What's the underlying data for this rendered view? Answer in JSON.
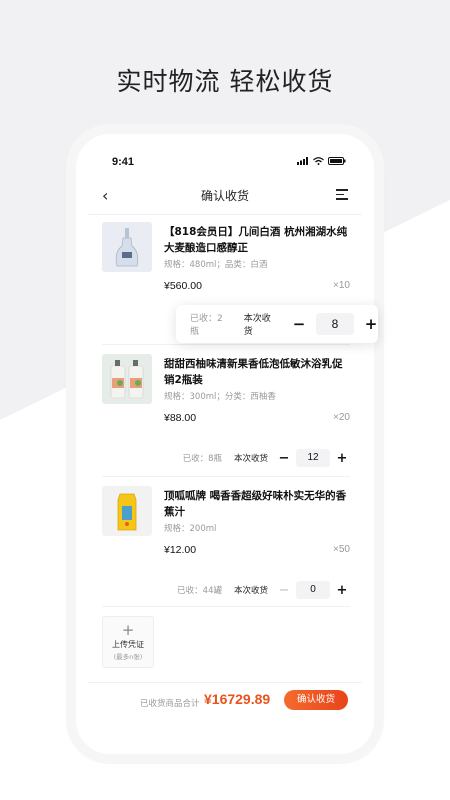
{
  "headline": "实时物流 轻松收货",
  "status": {
    "time": "9:41"
  },
  "nav": {
    "title": "确认收货"
  },
  "items": [
    {
      "name": "【818会员日】几间白酒  杭州湘湖水纯大麦酿造口感醇正",
      "spec": "规格：480ml；品类：白酒",
      "price": "¥560.00",
      "qty": "×10",
      "received": "已收：2瓶",
      "this_label": "本次收货",
      "this_value": "8"
    },
    {
      "name": "甜甜西柚味清新果香低泡低敏沐浴乳促销2瓶装",
      "spec": "规格：300ml；分类：西柚香",
      "price": "¥88.00",
      "qty": "×20",
      "received": "已收：8瓶",
      "this_label": "本次收货",
      "this_value": "12"
    },
    {
      "name": "顶呱呱牌 喝香香超级好味朴实无华的香蕉汁",
      "spec": "规格：200ml",
      "price": "¥12.00",
      "qty": "×50",
      "received": "已收：44罐",
      "this_label": "本次收货",
      "this_value": "0"
    }
  ],
  "upload": {
    "label": "上传凭证",
    "sub": "(最多n张)"
  },
  "footer": {
    "total_label": "已收货商品合计",
    "total": "¥16729.89",
    "confirm": "确认收货"
  },
  "colors": {
    "accent": "#e8531e"
  }
}
